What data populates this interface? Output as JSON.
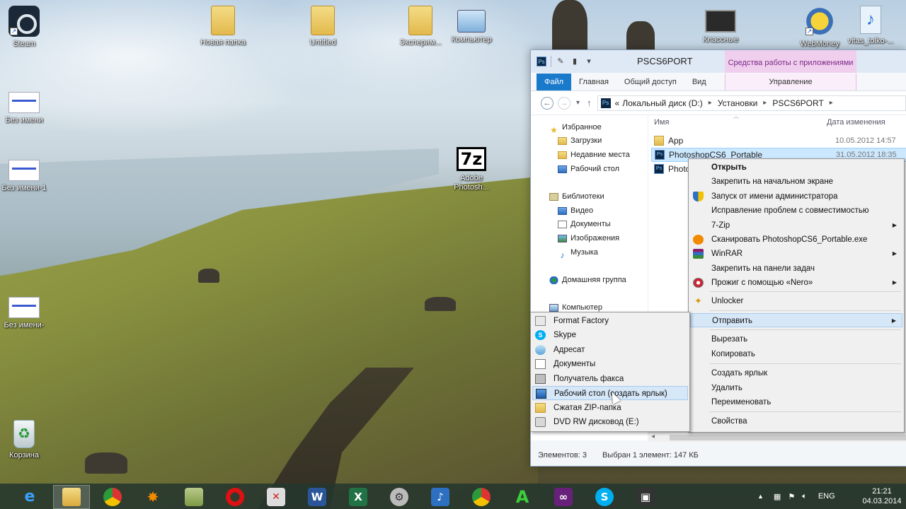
{
  "desktop": {
    "icons": [
      {
        "label": "Steam"
      },
      {
        "label": "Без имени"
      },
      {
        "label": "Без имени-1"
      },
      {
        "label": "Без имени-"
      },
      {
        "label": "Корзина"
      },
      {
        "label": "Новая папка"
      },
      {
        "label": "Untitled"
      },
      {
        "label": "Эксперим..."
      },
      {
        "label": "Компьютер"
      },
      {
        "label": "Adobe Photosh..."
      },
      {
        "label": "Классные"
      },
      {
        "label": "WebMoney"
      },
      {
        "label": "vitas_tolko-..."
      }
    ],
    "icon_7z_text": "7z"
  },
  "explorer": {
    "title": "PSCS6PORT",
    "ps_badge": "Ps",
    "context_tab_header": "Средства работы с приложениями",
    "tabs": [
      "Файл",
      "Главная",
      "Общий доступ",
      "Вид",
      "Управление"
    ],
    "address": {
      "overflow": "«",
      "crumbs": [
        "Локальный диск (D:)",
        "Установки",
        "PSCS6PORT"
      ]
    },
    "nav": {
      "favorites": "Избранное",
      "favorites_items": [
        "Загрузки",
        "Недавние места",
        "Рабочий стол"
      ],
      "libraries": "Библиотеки",
      "libraries_items": [
        "Видео",
        "Документы",
        "Изображения",
        "Музыка"
      ],
      "homegroup": "Домашняя группа",
      "computer": "Компьютер"
    },
    "columns": {
      "name": "Имя",
      "date": "Дата изменения"
    },
    "files": [
      {
        "name": "App",
        "date": "10.05.2012 14:57"
      },
      {
        "name": "PhotoshopCS6_Portable",
        "date": "31.05.2012 18:35"
      },
      {
        "name": "Photo",
        "date": ""
      }
    ],
    "status": {
      "count": "Элементов: 3",
      "selected": "Выбран 1 элемент: 147 КБ"
    }
  },
  "context_menu": {
    "items": [
      {
        "label": "Открыть",
        "bold": true
      },
      {
        "label": "Закрепить на начальном экране"
      },
      {
        "label": "Запуск от имени администратора"
      },
      {
        "label": "Исправление проблем с совместимостью"
      },
      {
        "label": "7-Zip",
        "submenu": true
      },
      {
        "label": "Сканировать PhotoshopCS6_Portable.exe"
      },
      {
        "label": "WinRAR",
        "submenu": true
      },
      {
        "label": "Закрепить на панели задач"
      },
      {
        "label": "Прожиг с помощью «Nero»",
        "submenu": true
      },
      {
        "label": "Unlocker"
      },
      {
        "label": "Отправить",
        "submenu": true,
        "highlighted": true
      },
      {
        "label": "Вырезать"
      },
      {
        "label": "Копировать"
      },
      {
        "label": "Создать ярлык"
      },
      {
        "label": "Удалить"
      },
      {
        "label": "Переименовать"
      },
      {
        "label": "Свойства"
      }
    ]
  },
  "sendto_menu": {
    "items": [
      {
        "label": "Format Factory"
      },
      {
        "label": "Skype"
      },
      {
        "label": "Адресат"
      },
      {
        "label": "Документы"
      },
      {
        "label": "Получатель факса"
      },
      {
        "label": "Рабочий стол (создать ярлык)",
        "highlighted": true
      },
      {
        "label": "Сжатая ZIP-папка"
      },
      {
        "label": "DVD RW дисковод (E:)"
      }
    ]
  },
  "taskbar": {
    "language": "ENG",
    "time": "21:21",
    "date": "04.03.2014"
  }
}
